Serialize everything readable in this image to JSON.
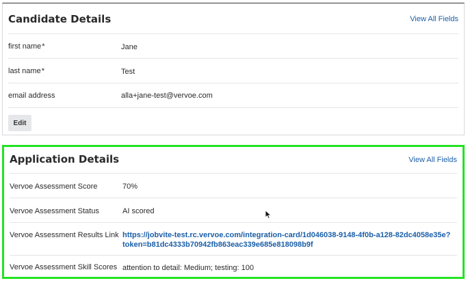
{
  "candidate": {
    "title": "Candidate Details",
    "view_all": "View All Fields",
    "fields": [
      {
        "label": "first name",
        "required": "*",
        "value": "Jane"
      },
      {
        "label": "last name",
        "required": "*",
        "value": "Test"
      },
      {
        "label": "email address",
        "required": "",
        "value": "alla+jane-test@vervoe.com"
      }
    ],
    "edit_label": "Edit"
  },
  "application": {
    "title": "Application Details",
    "view_all": "View All Fields",
    "fields": [
      {
        "label": "Vervoe Assessment Score",
        "value": "70%"
      },
      {
        "label": "Vervoe Assessment Status",
        "value": "AI scored"
      },
      {
        "label": "Vervoe Assessment Results Link",
        "link_line1": "https://jobvite-test.rc.vervoe.com/integration-card/1d046038-9148-4f0b-a128-82dc4058e35e?",
        "link_line2": "token=b81dc4333b70942fb863eac339e685e818098b9f"
      },
      {
        "label": "Vervoe Assessment Skill Scores",
        "value": "attention to detail: Medium; testing: 100"
      }
    ]
  },
  "colors": {
    "link": "#1a5ea8",
    "highlight_border": "#22e322",
    "edit_button_bg": "#e6e7ea"
  },
  "icons": {
    "cursor": "mouse-pointer-icon"
  }
}
